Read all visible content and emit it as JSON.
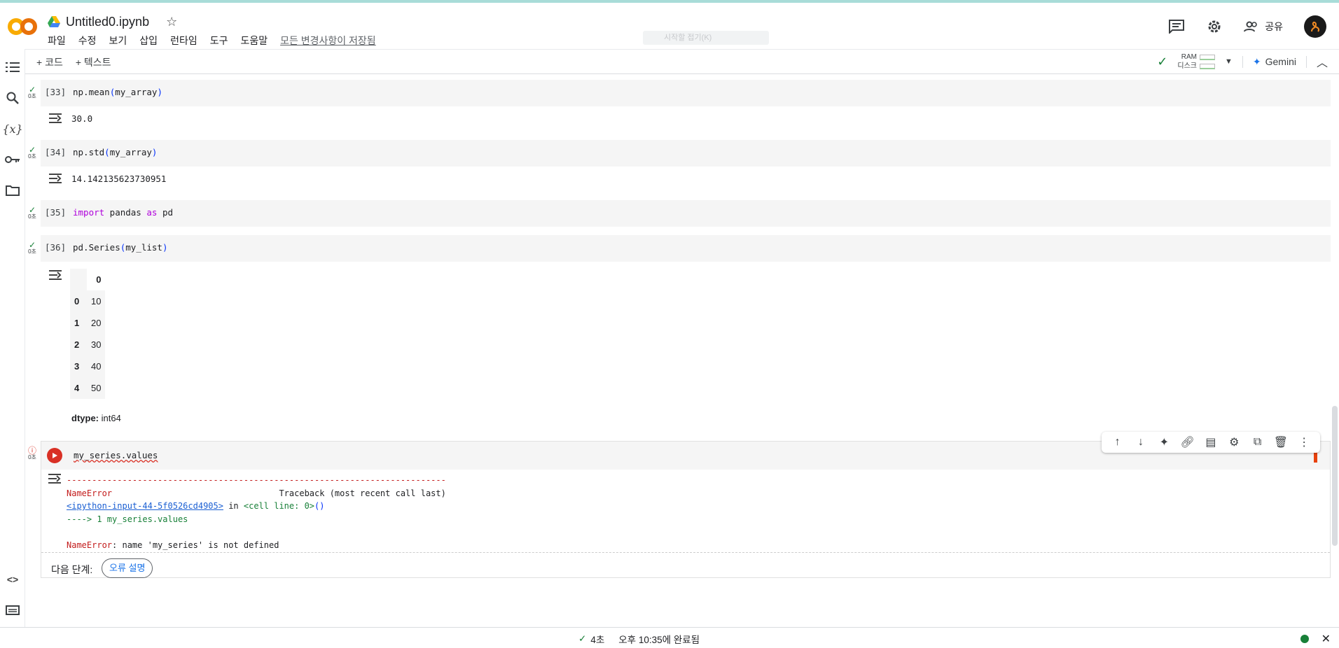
{
  "header": {
    "title": "Untitled0.ipynb",
    "menu": [
      "파일",
      "수정",
      "보기",
      "삽입",
      "런타임",
      "도구",
      "도움말"
    ],
    "saved_status": "모든 변경사항이 저장됨",
    "share_label": "공유",
    "search_placeholder": "시작할 접기(K)"
  },
  "toolbar": {
    "add_code": "+ 코드",
    "add_text": "+ 텍스트",
    "ram_label": "RAM",
    "disk_label": "디스크",
    "gemini_label": "Gemini"
  },
  "cells": [
    {
      "exec": "[33]",
      "status": "0초",
      "code": "np.mean",
      "arg": "my_array",
      "output": "30.0"
    },
    {
      "exec": "[34]",
      "status": "0초",
      "code": "np.std",
      "arg": "my_array",
      "output": "14.142135623730951"
    },
    {
      "exec": "[35]",
      "status": "0초",
      "kw1": "import",
      "mid": " pandas ",
      "kw2": "as",
      "tail": " pd"
    },
    {
      "exec": "[36]",
      "status": "0초",
      "code": "pd.Series",
      "arg": "my_list"
    }
  ],
  "series_table": {
    "header": "0",
    "rows": [
      {
        "idx": "0",
        "val": "10"
      },
      {
        "idx": "1",
        "val": "20"
      },
      {
        "idx": "2",
        "val": "30"
      },
      {
        "idx": "3",
        "val": "40"
      },
      {
        "idx": "4",
        "val": "50"
      }
    ],
    "dtype_label": "dtype:",
    "dtype_value": "int64"
  },
  "error_cell": {
    "status": "0초",
    "code": "my_series.values",
    "dashes": "---------------------------------------------------------------------------",
    "err_name": "NameError",
    "traceback": "                                 Traceback (most recent call last)",
    "input_link": "<ipython-input-44-5f0526cd4905>",
    "in_word": " in ",
    "cell_line": "<cell line: 0>",
    "cell_line_paren": "()",
    "arrow_line": "----> 1 my_series.values",
    "err_msg_name": "NameError",
    "err_msg": ": name 'my_series' is not defined",
    "next_label": "다음 단계:",
    "next_button": "오류 설명"
  },
  "statusbar": {
    "duration": "4초",
    "completed": "오후 10:35에 완료됨"
  }
}
